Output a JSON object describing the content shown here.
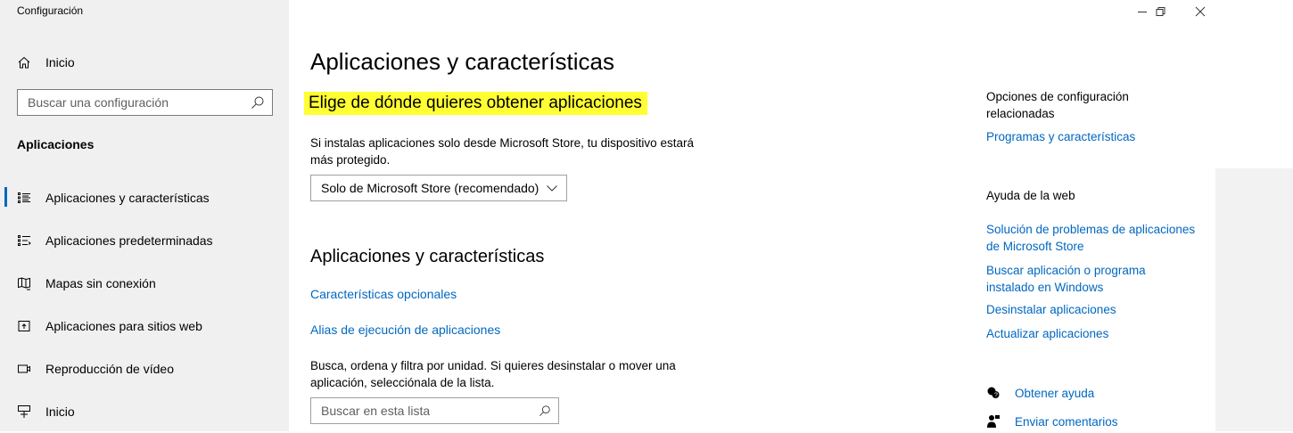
{
  "window": {
    "title": "Configuración",
    "controls": {
      "minimize_icon": "minimize-icon",
      "restore_icon": "restore-icon",
      "close_icon": "close-icon"
    }
  },
  "sidebar": {
    "home_label": "Inicio",
    "search_placeholder": "Buscar una configuración",
    "section_label": "Aplicaciones",
    "items": [
      {
        "label": "Aplicaciones y características",
        "icon": "apps-features-icon",
        "active": true
      },
      {
        "label": "Aplicaciones predeterminadas",
        "icon": "default-apps-icon",
        "active": false
      },
      {
        "label": "Mapas sin conexión",
        "icon": "offline-maps-icon",
        "active": false
      },
      {
        "label": "Aplicaciones para sitios web",
        "icon": "apps-websites-icon",
        "active": false
      },
      {
        "label": "Reproducción de vídeo",
        "icon": "video-playback-icon",
        "active": false
      },
      {
        "label": "Inicio",
        "icon": "startup-icon",
        "active": false
      }
    ]
  },
  "main": {
    "title": "Aplicaciones y características",
    "source_heading": "Elige de dónde quieres obtener aplicaciones",
    "source_description": "Si instalas aplicaciones solo desde Microsoft Store, tu dispositivo estará más protegido.",
    "source_dropdown_value": "Solo de Microsoft Store (recomendado)",
    "apps_heading": "Aplicaciones y características",
    "optional_features_link": "Características opcionales",
    "execution_alias_link": "Alias de ejecución de aplicaciones",
    "list_description": "Busca, ordena y filtra por unidad. Si quieres desinstalar o mover una aplicación, selecciónala de la lista.",
    "list_search_placeholder": "Buscar en esta lista"
  },
  "related": {
    "heading": "Opciones de configuración relacionadas",
    "programs_link": "Programas y características",
    "web_help_heading": "Ayuda de la web",
    "web_links": [
      "Solución de problemas de aplicaciones de Microsoft Store",
      "Buscar aplicación o programa instalado en Windows",
      "Desinstalar aplicaciones",
      "Actualizar aplicaciones"
    ],
    "get_help": "Obtener ayuda",
    "send_feedback": "Enviar comentarios"
  },
  "colors": {
    "accent": "#0067c0",
    "highlight": "#ffff33",
    "sidebar_bg": "#f0f0f0"
  }
}
